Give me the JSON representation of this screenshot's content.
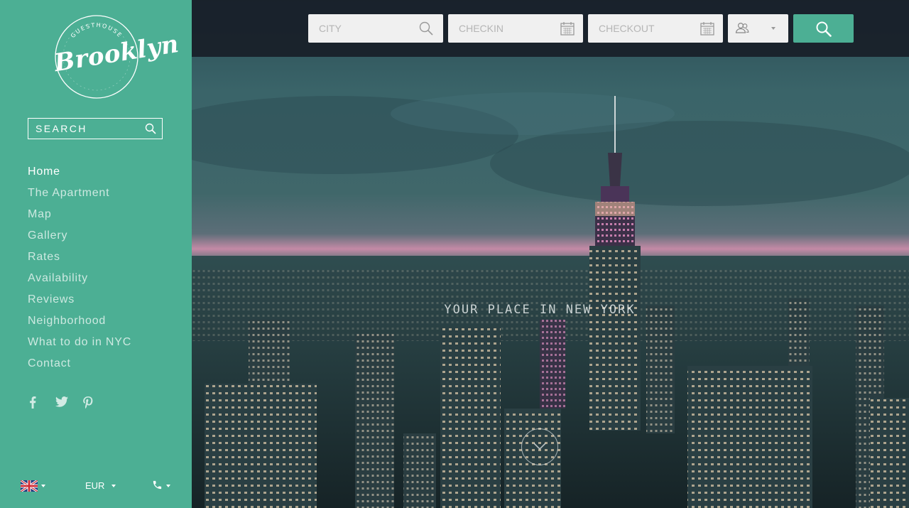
{
  "brand": {
    "name": "Brooklyn",
    "ring_text": "GUESTHOUSE"
  },
  "sidebar": {
    "search_placeholder": "SEARCH",
    "nav": [
      {
        "label": "Home",
        "active": true
      },
      {
        "label": "The Apartment",
        "active": false
      },
      {
        "label": "Map",
        "active": false
      },
      {
        "label": "Gallery",
        "active": false
      },
      {
        "label": "Rates",
        "active": false
      },
      {
        "label": "Availability",
        "active": false
      },
      {
        "label": "Reviews",
        "active": false
      },
      {
        "label": "Neighborhood",
        "active": false
      },
      {
        "label": "What to do in NYC",
        "active": false
      },
      {
        "label": "Contact",
        "active": false
      }
    ],
    "social_icons": [
      "facebook-icon",
      "twitter-icon",
      "pinterest-icon"
    ],
    "footer": {
      "language_icon": "uk-flag-icon",
      "currency": "EUR",
      "phone_icon": "phone-icon"
    }
  },
  "booking_bar": {
    "city_placeholder": "CITY",
    "checkin_placeholder": "CHECKIN",
    "checkout_placeholder": "CHECKOUT",
    "guests_icon": "guests-icon",
    "search_icon": "search-icon"
  },
  "hero": {
    "tagline": "YOUR PLACE IN NEW YORK",
    "scroll_icon": "chevron-down-icon"
  },
  "colors": {
    "accent": "#4caf94",
    "topbar": "#181e28",
    "field_bg": "#f0f0f0"
  }
}
